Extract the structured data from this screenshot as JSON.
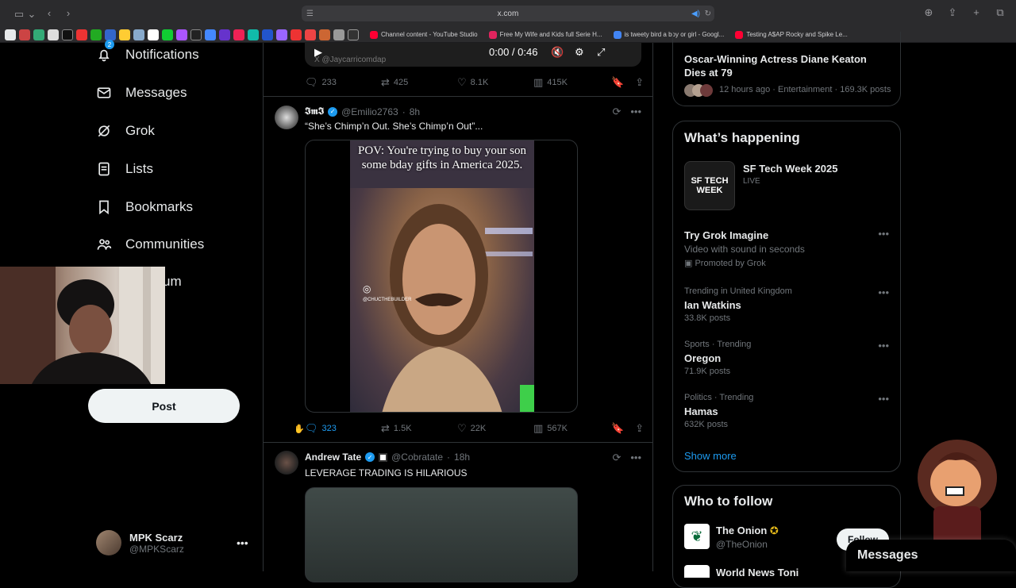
{
  "browser": {
    "url": "x.com",
    "bookmarks": [
      {
        "label": "Channel content - YouTube Studio",
        "color": "#ff0033"
      },
      {
        "label": "Free My Wife and Kids full Serie H...",
        "color": "#e0245e"
      },
      {
        "label": "is tweety bird a boy or girl - Googl...",
        "color": "#4285f4"
      },
      {
        "label": "Testing A$AP Rocky and Spike Le...",
        "color": "#ff0033"
      }
    ]
  },
  "nav": {
    "notifications": "Notifications",
    "notifications_badge": "2",
    "messages": "Messages",
    "grok": "Grok",
    "lists": "Lists",
    "bookmarks": "Bookmarks",
    "communities": "Communities",
    "premium_partial": "um",
    "post_button": "Post"
  },
  "profile": {
    "name": "MPK Scarz",
    "handle": "@MPKScarz"
  },
  "feed": {
    "top_video": {
      "time": "0:00 / 0:46",
      "watermark": "X @Jaycarricomdap"
    },
    "top_actions": {
      "replies": "233",
      "reposts": "425",
      "likes": "8.1K",
      "views": "415K"
    },
    "tweet1": {
      "name": "𝕴𝖒𝕴",
      "handle": "@Emilio2763",
      "time": "8h",
      "text": "“She’s Chimp’n Out. She’s Chimp’n Out”...",
      "media_caption": "POV: You're trying to buy your son some bday gifts in America 2025.",
      "media_watermark": "@CHUCTHEBUILDER",
      "actions": {
        "replies": "323",
        "reposts": "1.5K",
        "likes": "22K",
        "views": "567K"
      }
    },
    "tweet2": {
      "name": "Andrew Tate",
      "handle": "@Cobratate",
      "time": "18h",
      "text": "LEVERAGE TRADING IS HILARIOUS"
    }
  },
  "sidebar": {
    "news_top": {
      "title": "Oscar-Winning Actress Diane Keaton Dies at 79",
      "meta": "12 hours ago · Entertainment · 169.3K posts"
    },
    "happening": {
      "title": "What’s happening",
      "event": {
        "title": "SF Tech Week 2025",
        "status": "LIVE",
        "thumb_text": "SF TECH WEEK"
      },
      "promo": {
        "title": "Try Grok Imagine",
        "subtitle": "Video with sound in seconds",
        "promoted": "Promoted by Grok"
      },
      "trends": [
        {
          "meta": "Trending in United Kingdom",
          "topic": "Ian Watkins",
          "posts": "33.8K posts"
        },
        {
          "meta": "Sports · Trending",
          "topic": "Oregon",
          "posts": "71.9K posts"
        },
        {
          "meta": "Politics · Trending",
          "topic": "Hamas",
          "posts": "632K posts"
        }
      ],
      "show_more": "Show more"
    },
    "who_to_follow": {
      "title": "Who to follow",
      "accounts": [
        {
          "name": "The Onion",
          "handle": "@TheOnion",
          "button": "Follow"
        },
        {
          "name": "World News Toni",
          "handle": "",
          "button": ""
        }
      ]
    }
  },
  "messages_drawer": "Messages",
  "colors": {
    "accent": "#1d9bf0",
    "bg": "#000000",
    "border": "#2f3336",
    "muted": "#71767b"
  }
}
